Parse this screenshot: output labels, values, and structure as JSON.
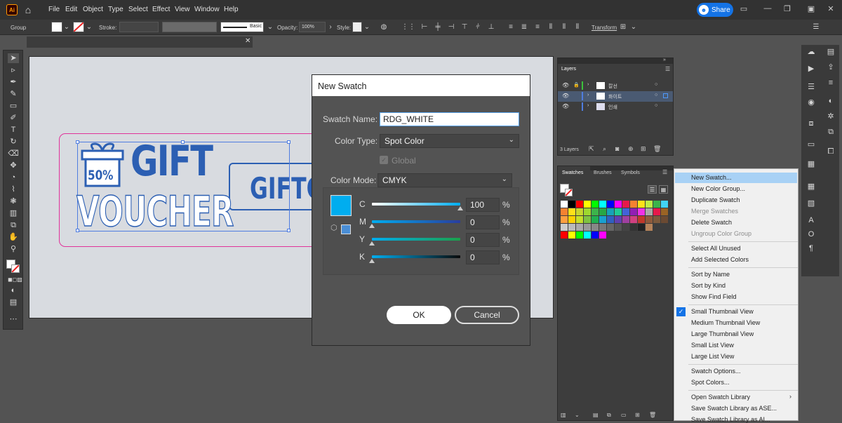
{
  "app": {
    "logo": "Ai"
  },
  "menu": [
    "File",
    "Edit",
    "Object",
    "Type",
    "Select",
    "Effect",
    "View",
    "Window",
    "Help"
  ],
  "share": {
    "label": "Share"
  },
  "control": {
    "selection": "Group",
    "stroke_label": "Stroke:",
    "brush": "Basic",
    "opacity_label": "Opacity:",
    "opacity_value": "100%",
    "style_label": "Style:",
    "transform": "Transform"
  },
  "artwork": {
    "percent": "50%",
    "gift": "GIFT",
    "voucher": "VOUCHER",
    "gift_co": "GIFTCO"
  },
  "dialog": {
    "title": "New Swatch",
    "swatch_name_label": "Swatch Name:",
    "swatch_name_value": "RDG_WHITE",
    "color_type_label": "Color Type:",
    "color_type_value": "Spot Color",
    "global_label": "Global",
    "color_mode_label": "Color Mode:",
    "color_mode_value": "CMYK",
    "channels": [
      {
        "label": "C",
        "value": "100",
        "pct": "%"
      },
      {
        "label": "M",
        "value": "0",
        "pct": "%"
      },
      {
        "label": "Y",
        "value": "0",
        "pct": "%"
      },
      {
        "label": "K",
        "value": "0",
        "pct": "%"
      }
    ],
    "swatch_color": "#00adef",
    "ok": "OK",
    "cancel": "Cancel"
  },
  "layers": {
    "tab": "Layers",
    "count": "3 Layers",
    "rows": [
      {
        "name": "칼선",
        "color": "#3cc23c"
      },
      {
        "name": "화이트",
        "color": "#4f7de0"
      },
      {
        "name": "인쇄",
        "color": "#4f7de0"
      }
    ]
  },
  "swatches": {
    "tabs": [
      "Swatches",
      "Brushes",
      "Symbols"
    ]
  },
  "flyout": {
    "items": [
      {
        "label": "New Swatch...",
        "state": "hover"
      },
      {
        "label": "New Color Group...",
        "state": "normal"
      },
      {
        "label": "Duplicate Swatch",
        "state": "normal"
      },
      {
        "label": "Merge Swatches",
        "state": "disabled"
      },
      {
        "label": "Delete Swatch",
        "state": "normal"
      },
      {
        "label": "Ungroup Color Group",
        "state": "disabled"
      },
      {
        "label": "Select All Unused",
        "state": "normal"
      },
      {
        "label": "Add Selected Colors",
        "state": "normal"
      },
      {
        "label": "Sort by Name",
        "state": "normal"
      },
      {
        "label": "Sort by Kind",
        "state": "normal"
      },
      {
        "label": "Show Find Field",
        "state": "normal"
      },
      {
        "label": "Small Thumbnail View",
        "state": "checked"
      },
      {
        "label": "Medium Thumbnail View",
        "state": "normal"
      },
      {
        "label": "Large Thumbnail View",
        "state": "normal"
      },
      {
        "label": "Small List View",
        "state": "normal"
      },
      {
        "label": "Large List View",
        "state": "normal"
      },
      {
        "label": "Swatch Options...",
        "state": "normal"
      },
      {
        "label": "Spot Colors...",
        "state": "normal"
      },
      {
        "label": "Open Swatch Library",
        "state": "submenu"
      },
      {
        "label": "Save Swatch Library as ASE...",
        "state": "normal"
      },
      {
        "label": "Save Swatch Library as AI...",
        "state": "normal"
      }
    ]
  },
  "colors": {
    "accent": "#1473e6",
    "hover": "#a8d1f5",
    "ok_bg": "#ffffff"
  }
}
